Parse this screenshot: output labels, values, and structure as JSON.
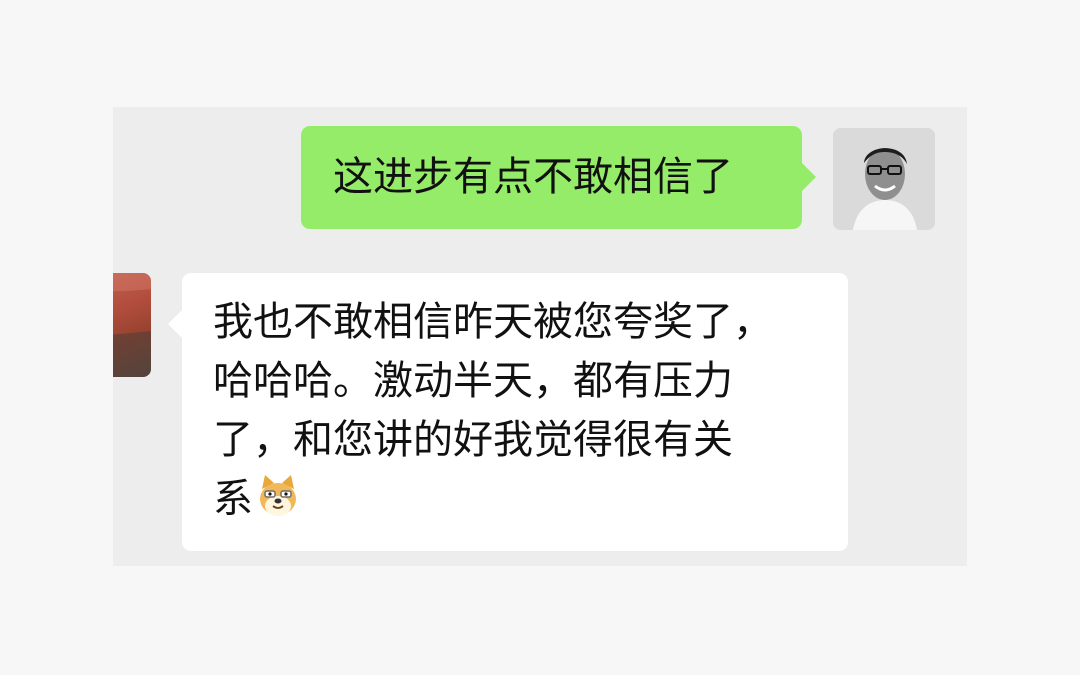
{
  "conversation": {
    "messages": [
      {
        "sender": "self",
        "avatar": "user-photo-avatar",
        "text": "这进步有点不敢相信了"
      },
      {
        "sender": "other",
        "avatar": "red-photo-avatar",
        "lines": [
          "我也不敢相信昨天被您夸奖了，",
          "哈哈哈。激动半天，都有压力",
          "了，和您讲的好我觉得很有关",
          "系"
        ],
        "emoji": "doge-emoji-icon"
      }
    ]
  },
  "colors": {
    "page_background": "#f7f7f7",
    "chat_background": "#ededed",
    "sent_bubble": "#95ec69",
    "received_bubble": "#ffffff",
    "text": "#111111"
  }
}
